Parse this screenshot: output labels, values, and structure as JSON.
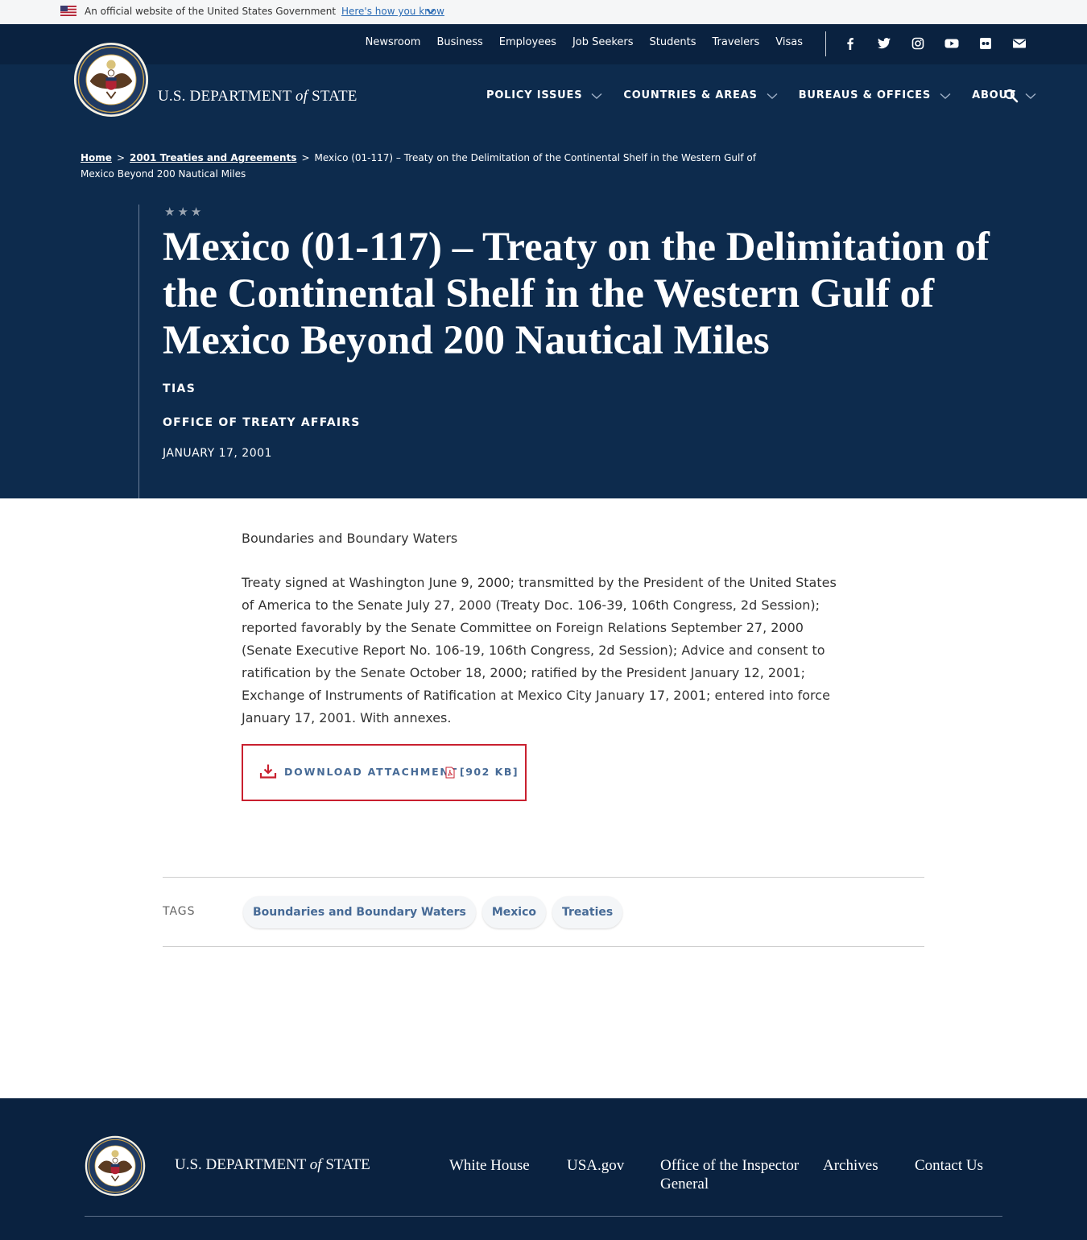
{
  "gov_banner": {
    "official_text": "An official website of the United States Government",
    "how_link": "Here's how you know"
  },
  "utility_nav": {
    "links": [
      "Newsroom",
      "Business",
      "Employees",
      "Job Seekers",
      "Students",
      "Travelers",
      "Visas"
    ],
    "social_icons": [
      "facebook-icon",
      "twitter-icon",
      "instagram-icon",
      "youtube-icon",
      "flickr-icon",
      "email-icon"
    ]
  },
  "brand": {
    "name_prefix": "U.S. DEPARTMENT",
    "name_of": "of",
    "name_suffix": "STATE"
  },
  "main_nav": {
    "items": [
      "POLICY ISSUES",
      "COUNTRIES & AREAS",
      "BUREAUS & OFFICES",
      "ABOUT"
    ]
  },
  "breadcrumb": {
    "home": "Home",
    "parent": "2001 Treaties and Agreements",
    "separator": ">",
    "current": "Mexico (01-117) – Treaty on the Delimitation of the Continental Shelf in the Western Gulf of Mexico Beyond 200 Nautical Miles"
  },
  "hero": {
    "stars": "★★★",
    "title": "Mexico (01-117) – Treaty on the Delimitation of the Continental Shelf in the Western Gulf of Mexico Beyond 200 Nautical Miles",
    "category": "TIAS",
    "office": "OFFICE OF TREATY AFFAIRS",
    "date": "JANUARY 17, 2001"
  },
  "content": {
    "topic": "Boundaries and Boundary Waters",
    "body": "Treaty signed at Washington June 9, 2000; transmitted by the President of the United States of America to the Senate July 27, 2000 (Treaty Doc. 106-39, 106th Congress, 2d Session); reported favorably by the Senate Committee on Foreign Relations September 27, 2000 (Senate Executive Report No. 106-19, 106th Congress, 2d Session); Advice and consent to ratification by the Senate October 18, 2000; ratified by the President January 12, 2001; Exchange of Instruments of Ratification at Mexico City January 17, 2001; entered into force January 17, 2001.  With annexes."
  },
  "download": {
    "label": "DOWNLOAD ATTACHMENT",
    "size": "[902 KB]"
  },
  "tags": {
    "label": "TAGS",
    "items": [
      "Boundaries and Boundary Waters",
      "Mexico",
      "Treaties"
    ]
  },
  "footer": {
    "links": [
      "White House",
      "USA.gov",
      "Office of the Inspector General",
      "Archives",
      "Contact Us"
    ]
  },
  "colors": {
    "utility_bg": "#0a2240",
    "hero_bg": "#0d2b4d",
    "accent_red": "#c9202f",
    "link_blue": "#466a96"
  }
}
